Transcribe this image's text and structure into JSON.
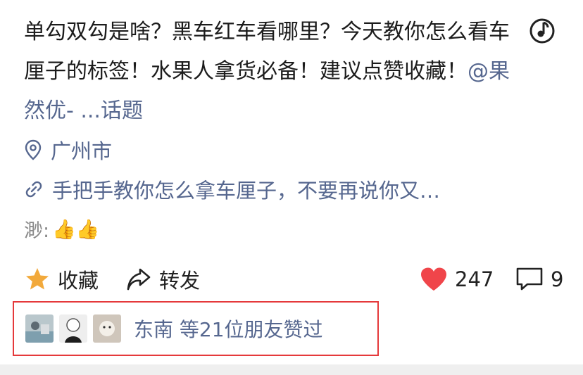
{
  "post": {
    "text": "单勾双勾是啥？黑车红车看哪里？今天教你怎么看车厘子的标签！水果人拿货必备！建议点赞收藏！",
    "mention": "@果然优- ...",
    "topic": "话题"
  },
  "location": {
    "icon": "location-pin-icon",
    "label": "广州市"
  },
  "link": {
    "icon": "link-icon",
    "label": "手把手教你怎么拿车厘子，不要再说你又…"
  },
  "reward": {
    "label": "渺:",
    "emoji": "👍👍"
  },
  "actions": {
    "favorite_label": "收藏",
    "forward_label": "转发",
    "like_count": "247",
    "comment_count": "9"
  },
  "liked_by": {
    "text": "东南 等21位朋友赞过"
  },
  "colors": {
    "link": "#56678f",
    "heart": "#f0454a",
    "star": "#f2a93b",
    "highlight_box": "#e5393b"
  }
}
